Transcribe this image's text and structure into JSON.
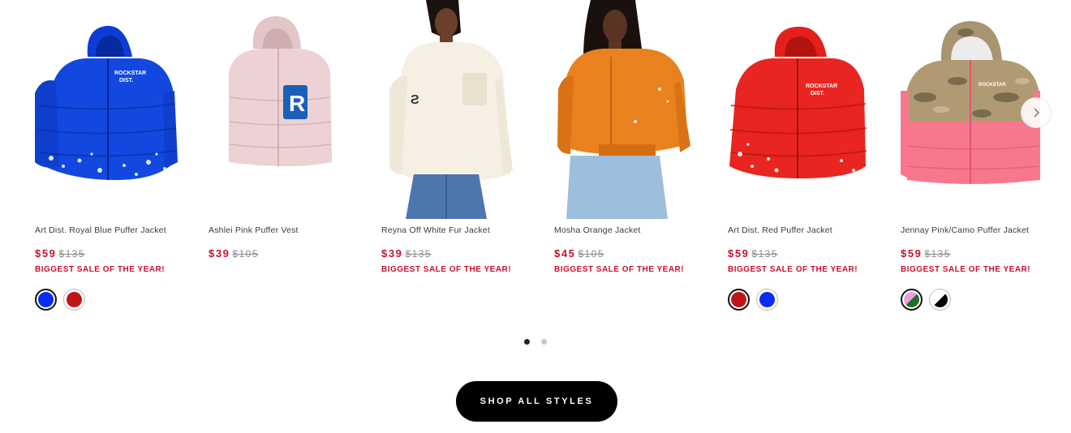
{
  "products": [
    {
      "title": "Art Dist. Royal Blue Puffer Jacket",
      "price": "$59",
      "compare_price": "$135",
      "promo": "BIGGEST SALE OF THE YEAR!",
      "image_icon": "blue-puffer-jacket-image",
      "swatches": [
        {
          "name": "royal-blue",
          "color": "#0a2cf0",
          "active": true
        },
        {
          "name": "red",
          "color": "#c0161a",
          "active": false
        }
      ]
    },
    {
      "title": "Ashlei Pink Puffer Vest",
      "price": "$39",
      "compare_price": "$105",
      "promo": "",
      "image_icon": "pink-puffer-vest-image",
      "swatches": []
    },
    {
      "title": "Reyna Off White Fur Jacket",
      "price": "$39",
      "compare_price": "$135",
      "promo": "BIGGEST SALE OF THE YEAR!",
      "image_icon": "white-fur-jacket-model-image",
      "swatches": []
    },
    {
      "title": "Mosha Orange Jacket",
      "price": "$45",
      "compare_price": "$105",
      "promo": "BIGGEST SALE OF THE YEAR!",
      "image_icon": "orange-jacket-model-image",
      "swatches": []
    },
    {
      "title": "Art Dist. Red Puffer Jacket",
      "price": "$59",
      "compare_price": "$135",
      "promo": "BIGGEST SALE OF THE YEAR!",
      "image_icon": "red-puffer-jacket-image",
      "swatches": [
        {
          "name": "red",
          "color": "#c0161a",
          "active": true
        },
        {
          "name": "royal-blue",
          "color": "#0a2cf0",
          "active": false
        }
      ]
    },
    {
      "title": "Jennay Pink/Camo Puffer Jacket",
      "price": "$59",
      "compare_price": "$135",
      "promo": "BIGGEST SALE OF THE YEAR!",
      "image_icon": "pink-camo-puffer-jacket-image",
      "swatches": [
        {
          "name": "pink-green",
          "colors": [
            "#e9a0e0",
            "#1f6e2a"
          ],
          "active": true
        },
        {
          "name": "white-black",
          "colors": [
            "#ffffff",
            "#000000"
          ],
          "active": false
        }
      ]
    }
  ],
  "carousel": {
    "next_icon": "chevron-right-icon",
    "page_count": 2,
    "active_page": 1
  },
  "cta": {
    "label": "SHOP ALL STYLES"
  },
  "colors": {
    "sale_red": "#c8102e",
    "button_black": "#000000"
  }
}
